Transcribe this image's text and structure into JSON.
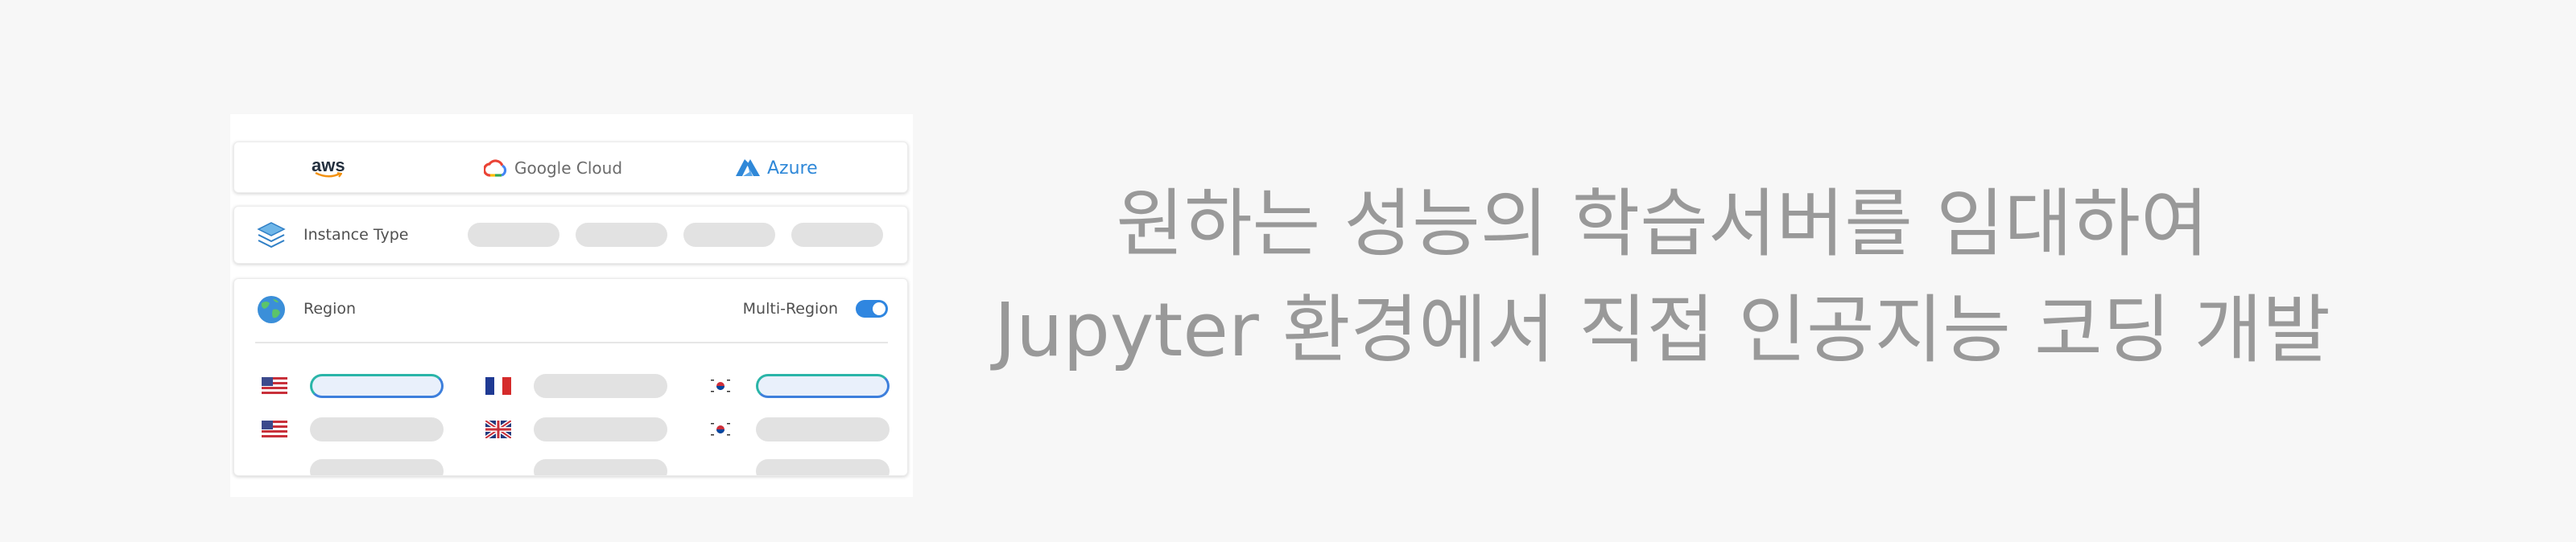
{
  "providers": [
    {
      "label": "aws",
      "icon": "aws-logo-icon"
    },
    {
      "label": "Google Cloud",
      "icon": "google-cloud-logo-icon"
    },
    {
      "label": "Azure",
      "icon": "azure-logo-icon"
    }
  ],
  "instance": {
    "label": "Instance Type",
    "icon": "layers-icon"
  },
  "region": {
    "label": "Region",
    "icon": "globe-icon",
    "multi_region_label": "Multi-Region",
    "multi_region_enabled": true
  },
  "headline": {
    "line1": "원하는 성능의 학습서버를 임대하여",
    "line2": "Jupyter 환경에서 직접 인공지능 코딩 개발"
  },
  "colors": {
    "accent": "#2f86e0",
    "selected_border": "#3d7fdc",
    "selected_teal": "#2ab5a8",
    "placeholder": "#e2e2e2",
    "headline": "#999999"
  }
}
